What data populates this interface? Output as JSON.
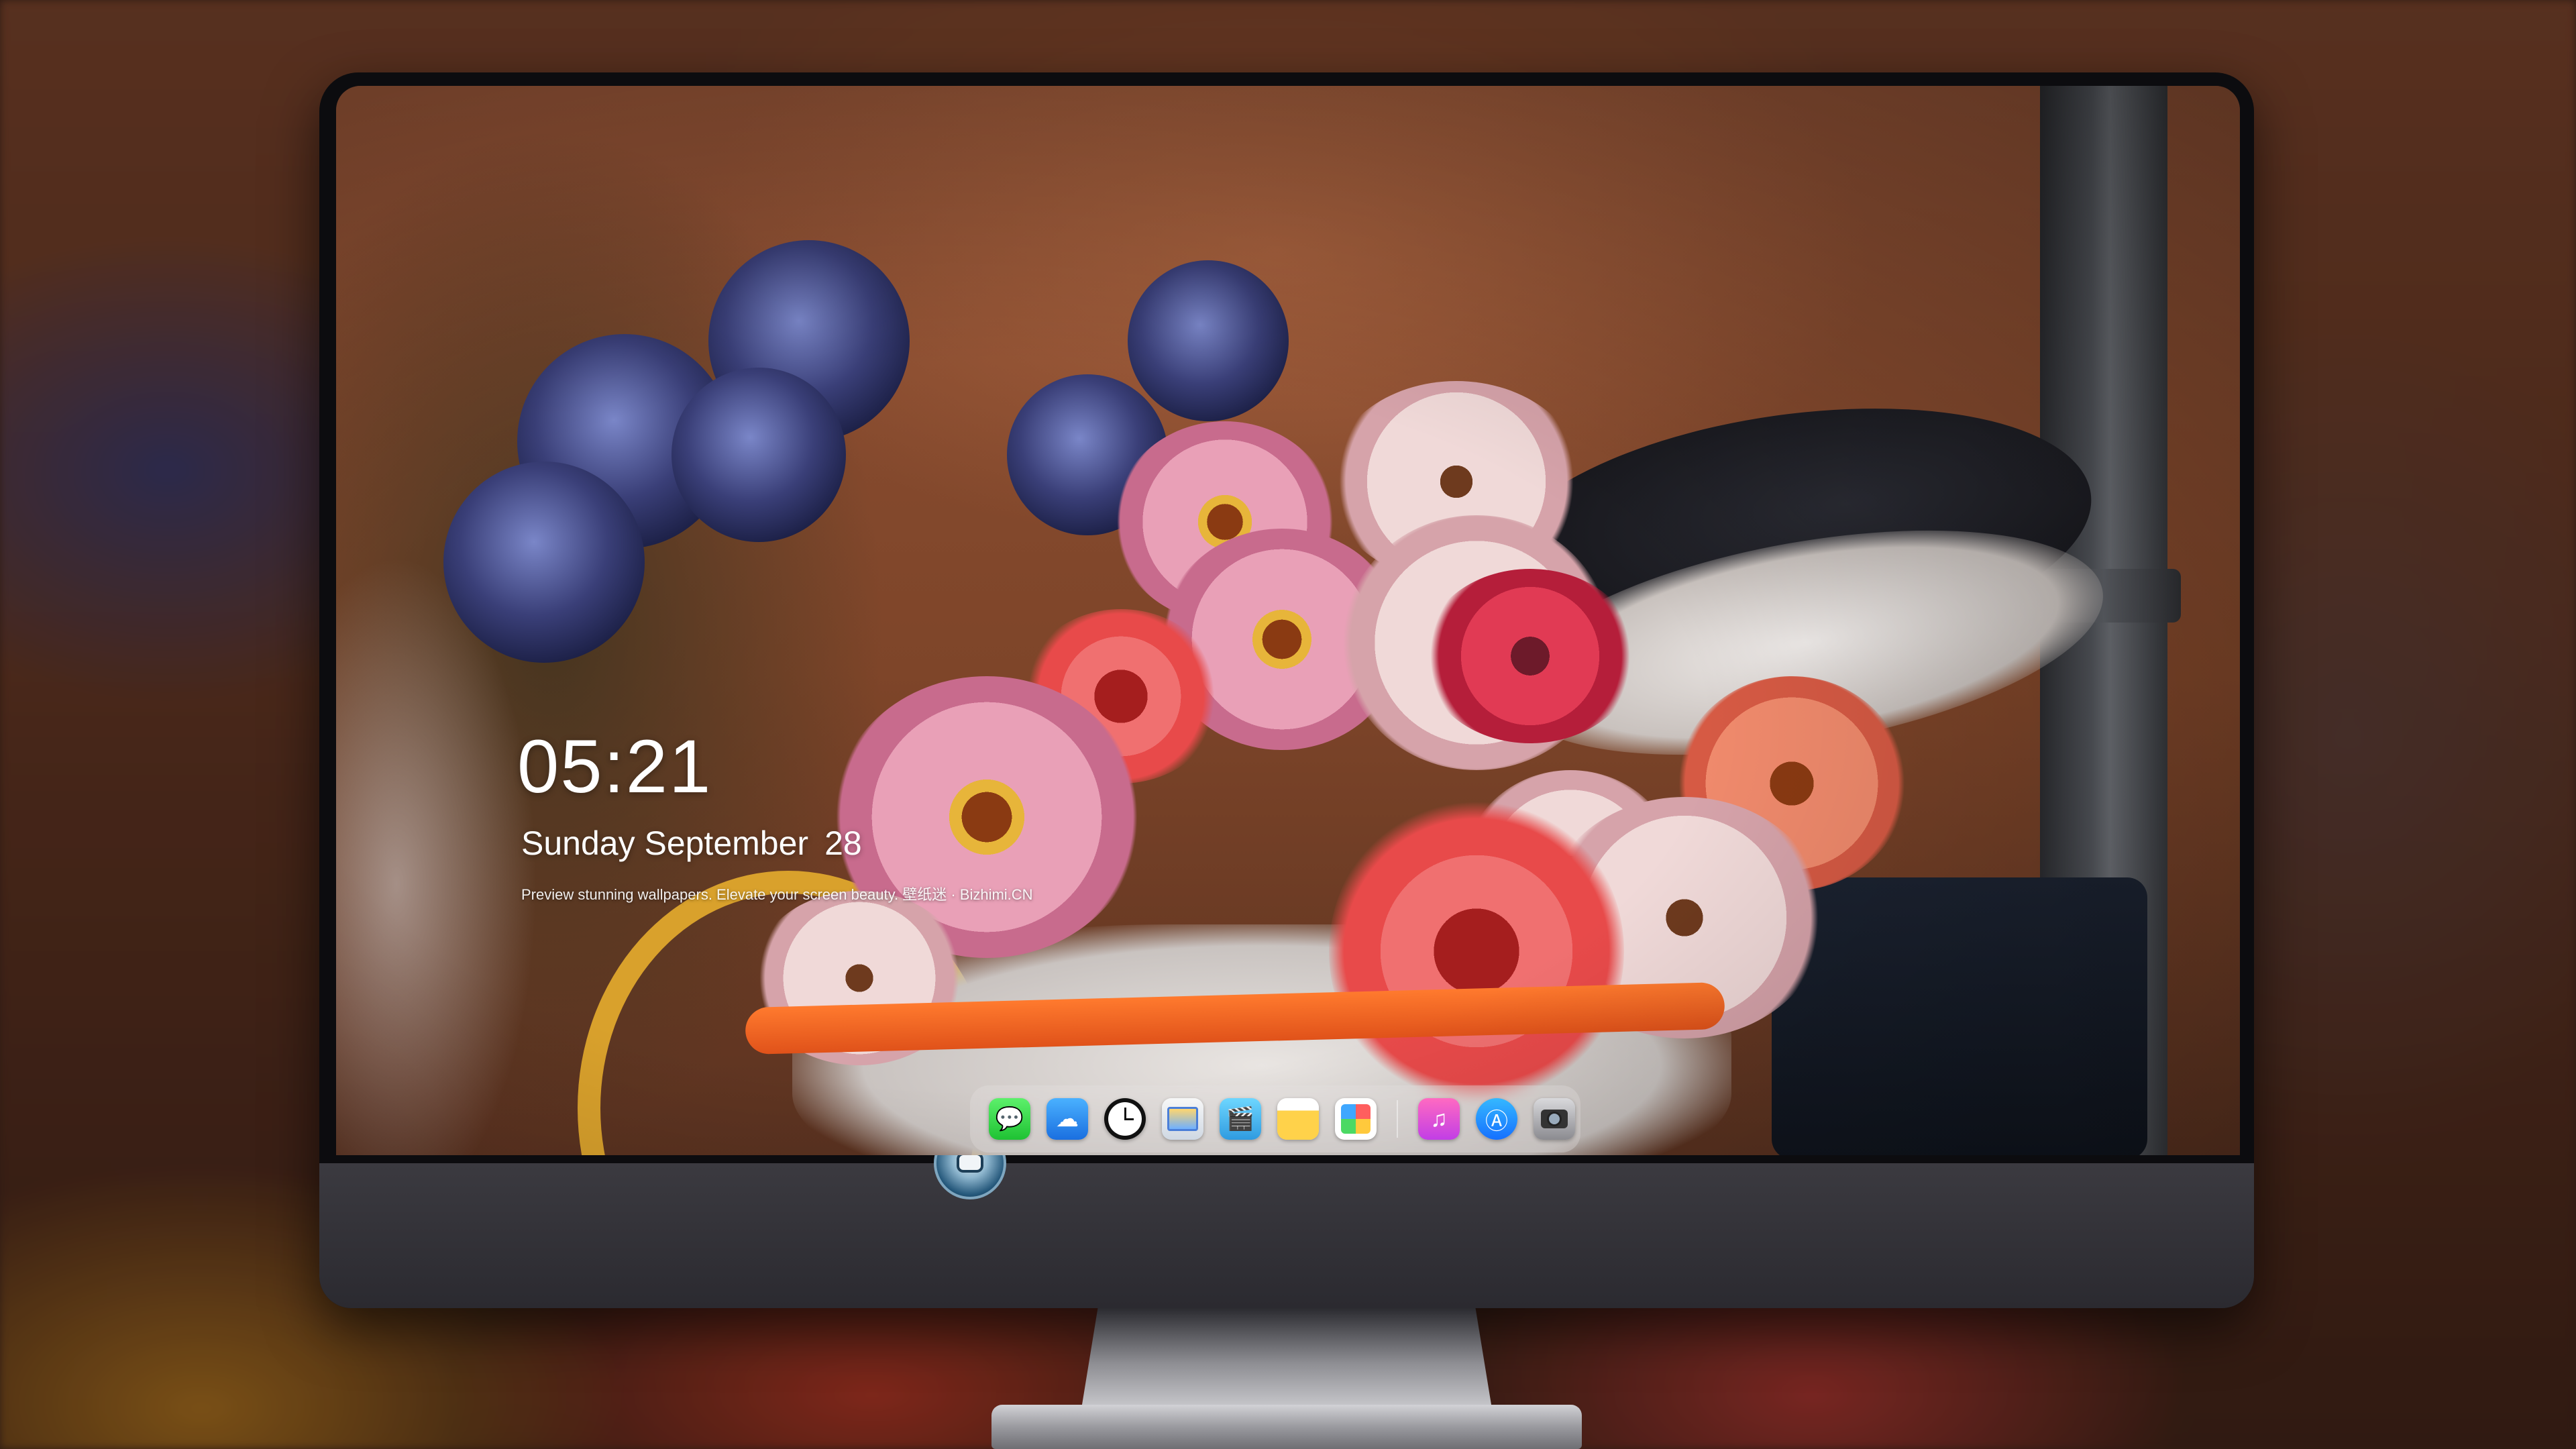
{
  "lockscreen": {
    "time": "05:21",
    "date_text": "Sunday September",
    "day_number": "28",
    "caption": "Preview stunning wallpapers. Elevate your screen beauty. 壁纸迷 · Bizhimi.CN"
  },
  "dock": {
    "items": [
      {
        "name": "messages",
        "icon": "message-bubble-icon",
        "glyph": "💬"
      },
      {
        "name": "weather",
        "icon": "cloud-icon",
        "glyph": "☁"
      },
      {
        "name": "clock",
        "icon": "clock-icon",
        "glyph": ""
      },
      {
        "name": "preview",
        "icon": "photo-preview-icon",
        "glyph": ""
      },
      {
        "name": "clips",
        "icon": "clapperboard-icon",
        "glyph": "🎬"
      },
      {
        "name": "notes",
        "icon": "notes-icon",
        "glyph": ""
      },
      {
        "name": "photos",
        "icon": "photos-icon",
        "glyph": ""
      },
      {
        "name": "music",
        "icon": "music-note-icon",
        "glyph": "♫"
      },
      {
        "name": "app-store",
        "icon": "app-store-icon",
        "glyph": "Ⓐ"
      },
      {
        "name": "camera",
        "icon": "camera-icon",
        "glyph": ""
      }
    ]
  },
  "colors": {
    "monitor_bezel": "#0c0c0f",
    "monitor_chin": "#333238",
    "dock_background": "rgba(235,230,230,0.28)",
    "wall": "#8e5034"
  }
}
